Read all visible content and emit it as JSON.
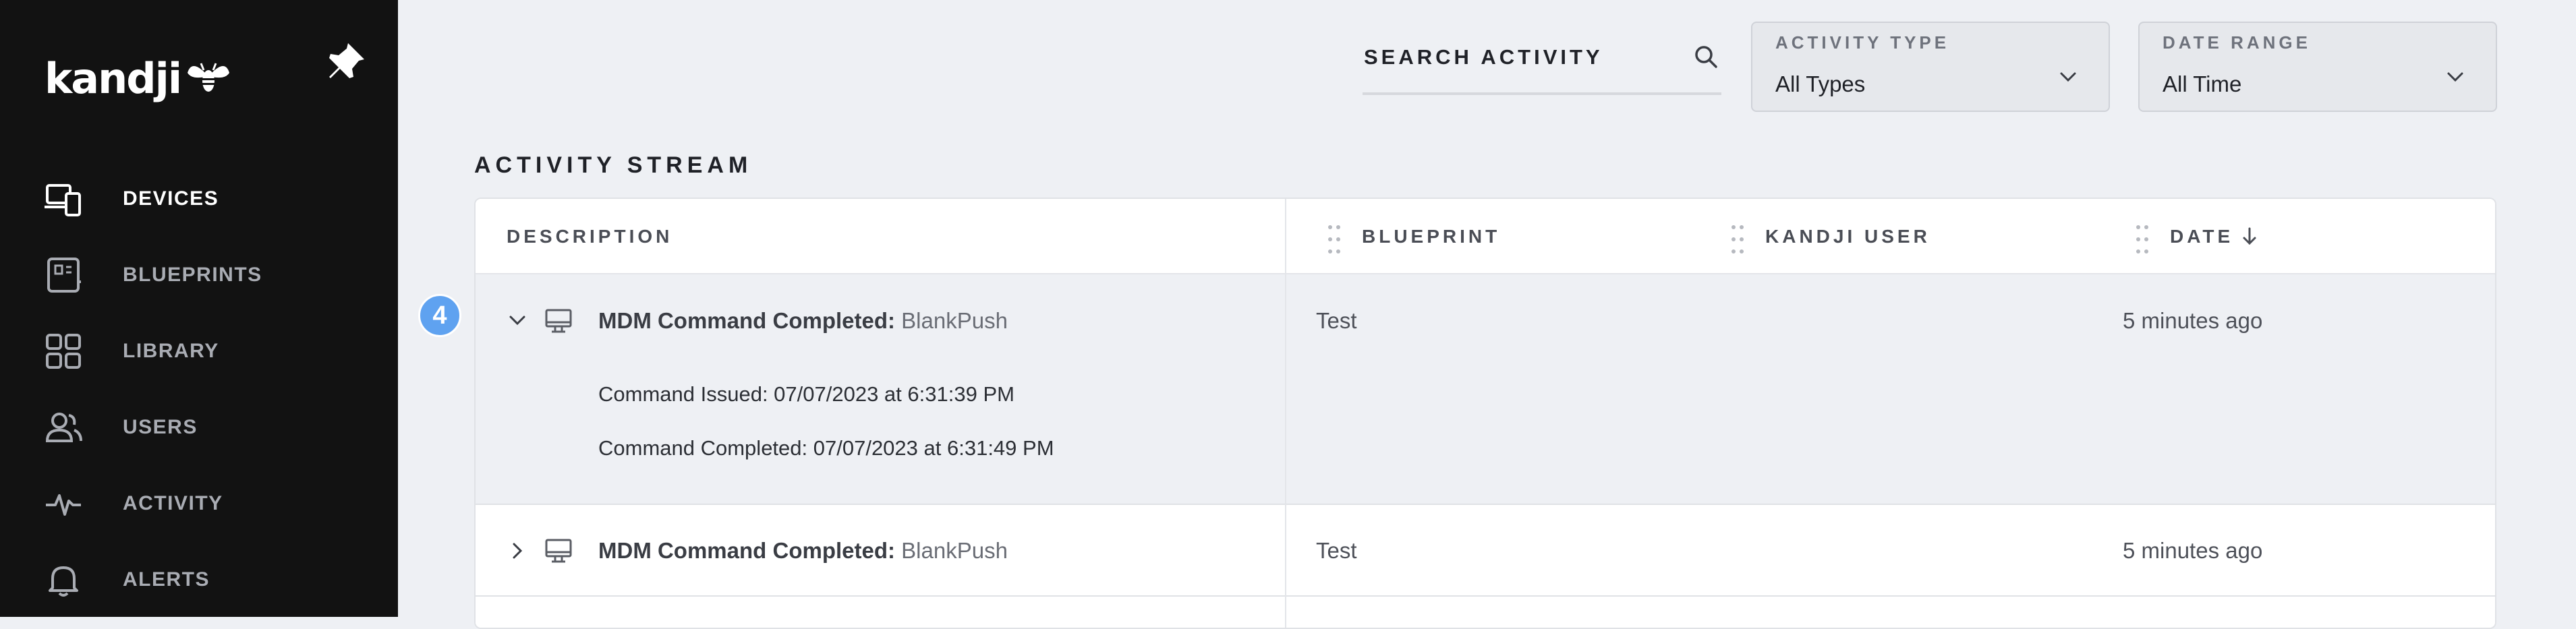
{
  "app": {
    "logo_text": "kandji"
  },
  "sidebar": {
    "items": [
      {
        "label": "DEVICES",
        "icon": "devices-icon",
        "active": true
      },
      {
        "label": "BLUEPRINTS",
        "icon": "blueprints-icon",
        "active": false
      },
      {
        "label": "LIBRARY",
        "icon": "library-icon",
        "active": false
      },
      {
        "label": "USERS",
        "icon": "users-icon",
        "active": false
      },
      {
        "label": "ACTIVITY",
        "icon": "activity-icon",
        "active": false
      },
      {
        "label": "ALERTS",
        "icon": "bell-icon",
        "active": false
      }
    ]
  },
  "filters": {
    "search_label": "SEARCH ACTIVITY",
    "activity_type": {
      "label": "ACTIVITY TYPE",
      "value": "All Types"
    },
    "date_range": {
      "label": "DATE RANGE",
      "value": "All Time"
    }
  },
  "activity": {
    "title": "ACTIVITY STREAM",
    "columns": [
      "DESCRIPTION",
      "BLUEPRINT",
      "KANDJI USER",
      "DATE"
    ],
    "rows": [
      {
        "expanded": true,
        "event": "MDM Command Completed:",
        "command": "BlankPush",
        "blueprint": "Test",
        "kandji_user": "",
        "date": "5 minutes ago",
        "details": [
          "Command Issued: 07/07/2023 at 6:31:39 PM",
          "Command Completed: 07/07/2023 at 6:31:49 PM"
        ]
      },
      {
        "expanded": false,
        "event": "MDM Command Completed:",
        "command": "BlankPush",
        "blueprint": "Test",
        "kandji_user": "",
        "date": "5 minutes ago"
      }
    ]
  },
  "annotation": {
    "badge": "4"
  },
  "colors": {
    "sidebar_bg": "#121212",
    "page_bg": "#eef0f4",
    "badge": "#5fa2f0"
  }
}
